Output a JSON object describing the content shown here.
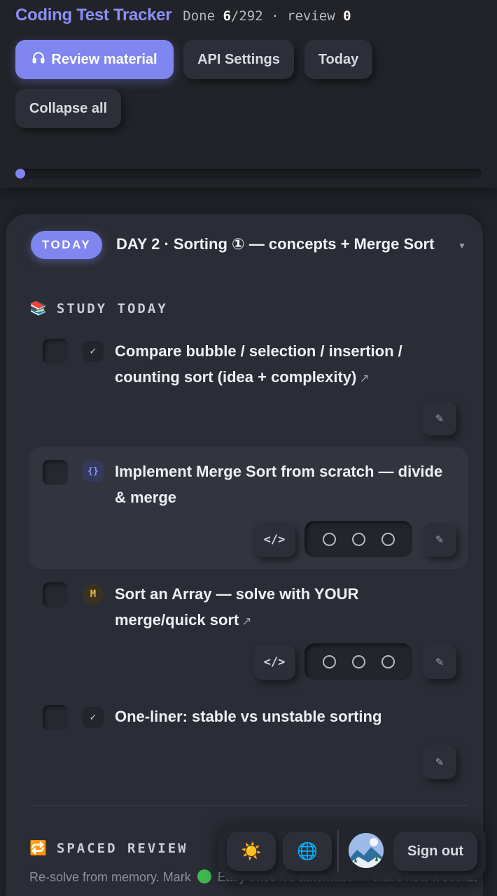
{
  "header": {
    "app_title": "Coding Test Tracker",
    "stats": {
      "done_label": "Done",
      "done_count": "6",
      "total": "/292",
      "separator": "·",
      "review_label": "review",
      "review_count": "0"
    },
    "buttons": {
      "review_material": "Review material",
      "api_settings": "API Settings",
      "today": "Today",
      "collapse_all": "Collapse all"
    },
    "progress_fraction": 0.02
  },
  "day_card": {
    "badge": "TODAY",
    "title": "DAY 2 · Sorting ① — concepts + Merge Sort",
    "study_section": {
      "emoji": "📚",
      "label": "STUDY TODAY"
    },
    "tasks": [
      {
        "tag": "✓",
        "tag_kind": "check",
        "text": "Compare bubble / selection / insertion / counting sort (idea + complexity)",
        "external": "↗"
      },
      {
        "tag": "{}",
        "tag_kind": "code",
        "text": "Implement Merge Sort from scratch — divide & merge",
        "code_label": "</>"
      },
      {
        "tag": "M",
        "tag_kind": "medium",
        "text": "Sort an Array — solve with YOUR merge/quick sort",
        "external": "↗",
        "code_label": "</>"
      },
      {
        "tag": "✓",
        "tag_kind": "check",
        "text": "One-liner: stable vs unstable sorting"
      }
    ],
    "edit_icon": "✎",
    "spaced_review": {
      "emoji": "🔁",
      "label": "SPACED REVIEW",
      "desc_before": "Re-solve from memory. Mark",
      "desc_after": "Easy once it's automatic — that's how it sticks."
    }
  },
  "toolbar": {
    "theme_icon": "☀️",
    "language_icon": "🌐",
    "sign_out": "Sign out"
  },
  "colors": {
    "accent": "#7f86f0",
    "background": "#212329",
    "card": "#2a2d35"
  }
}
